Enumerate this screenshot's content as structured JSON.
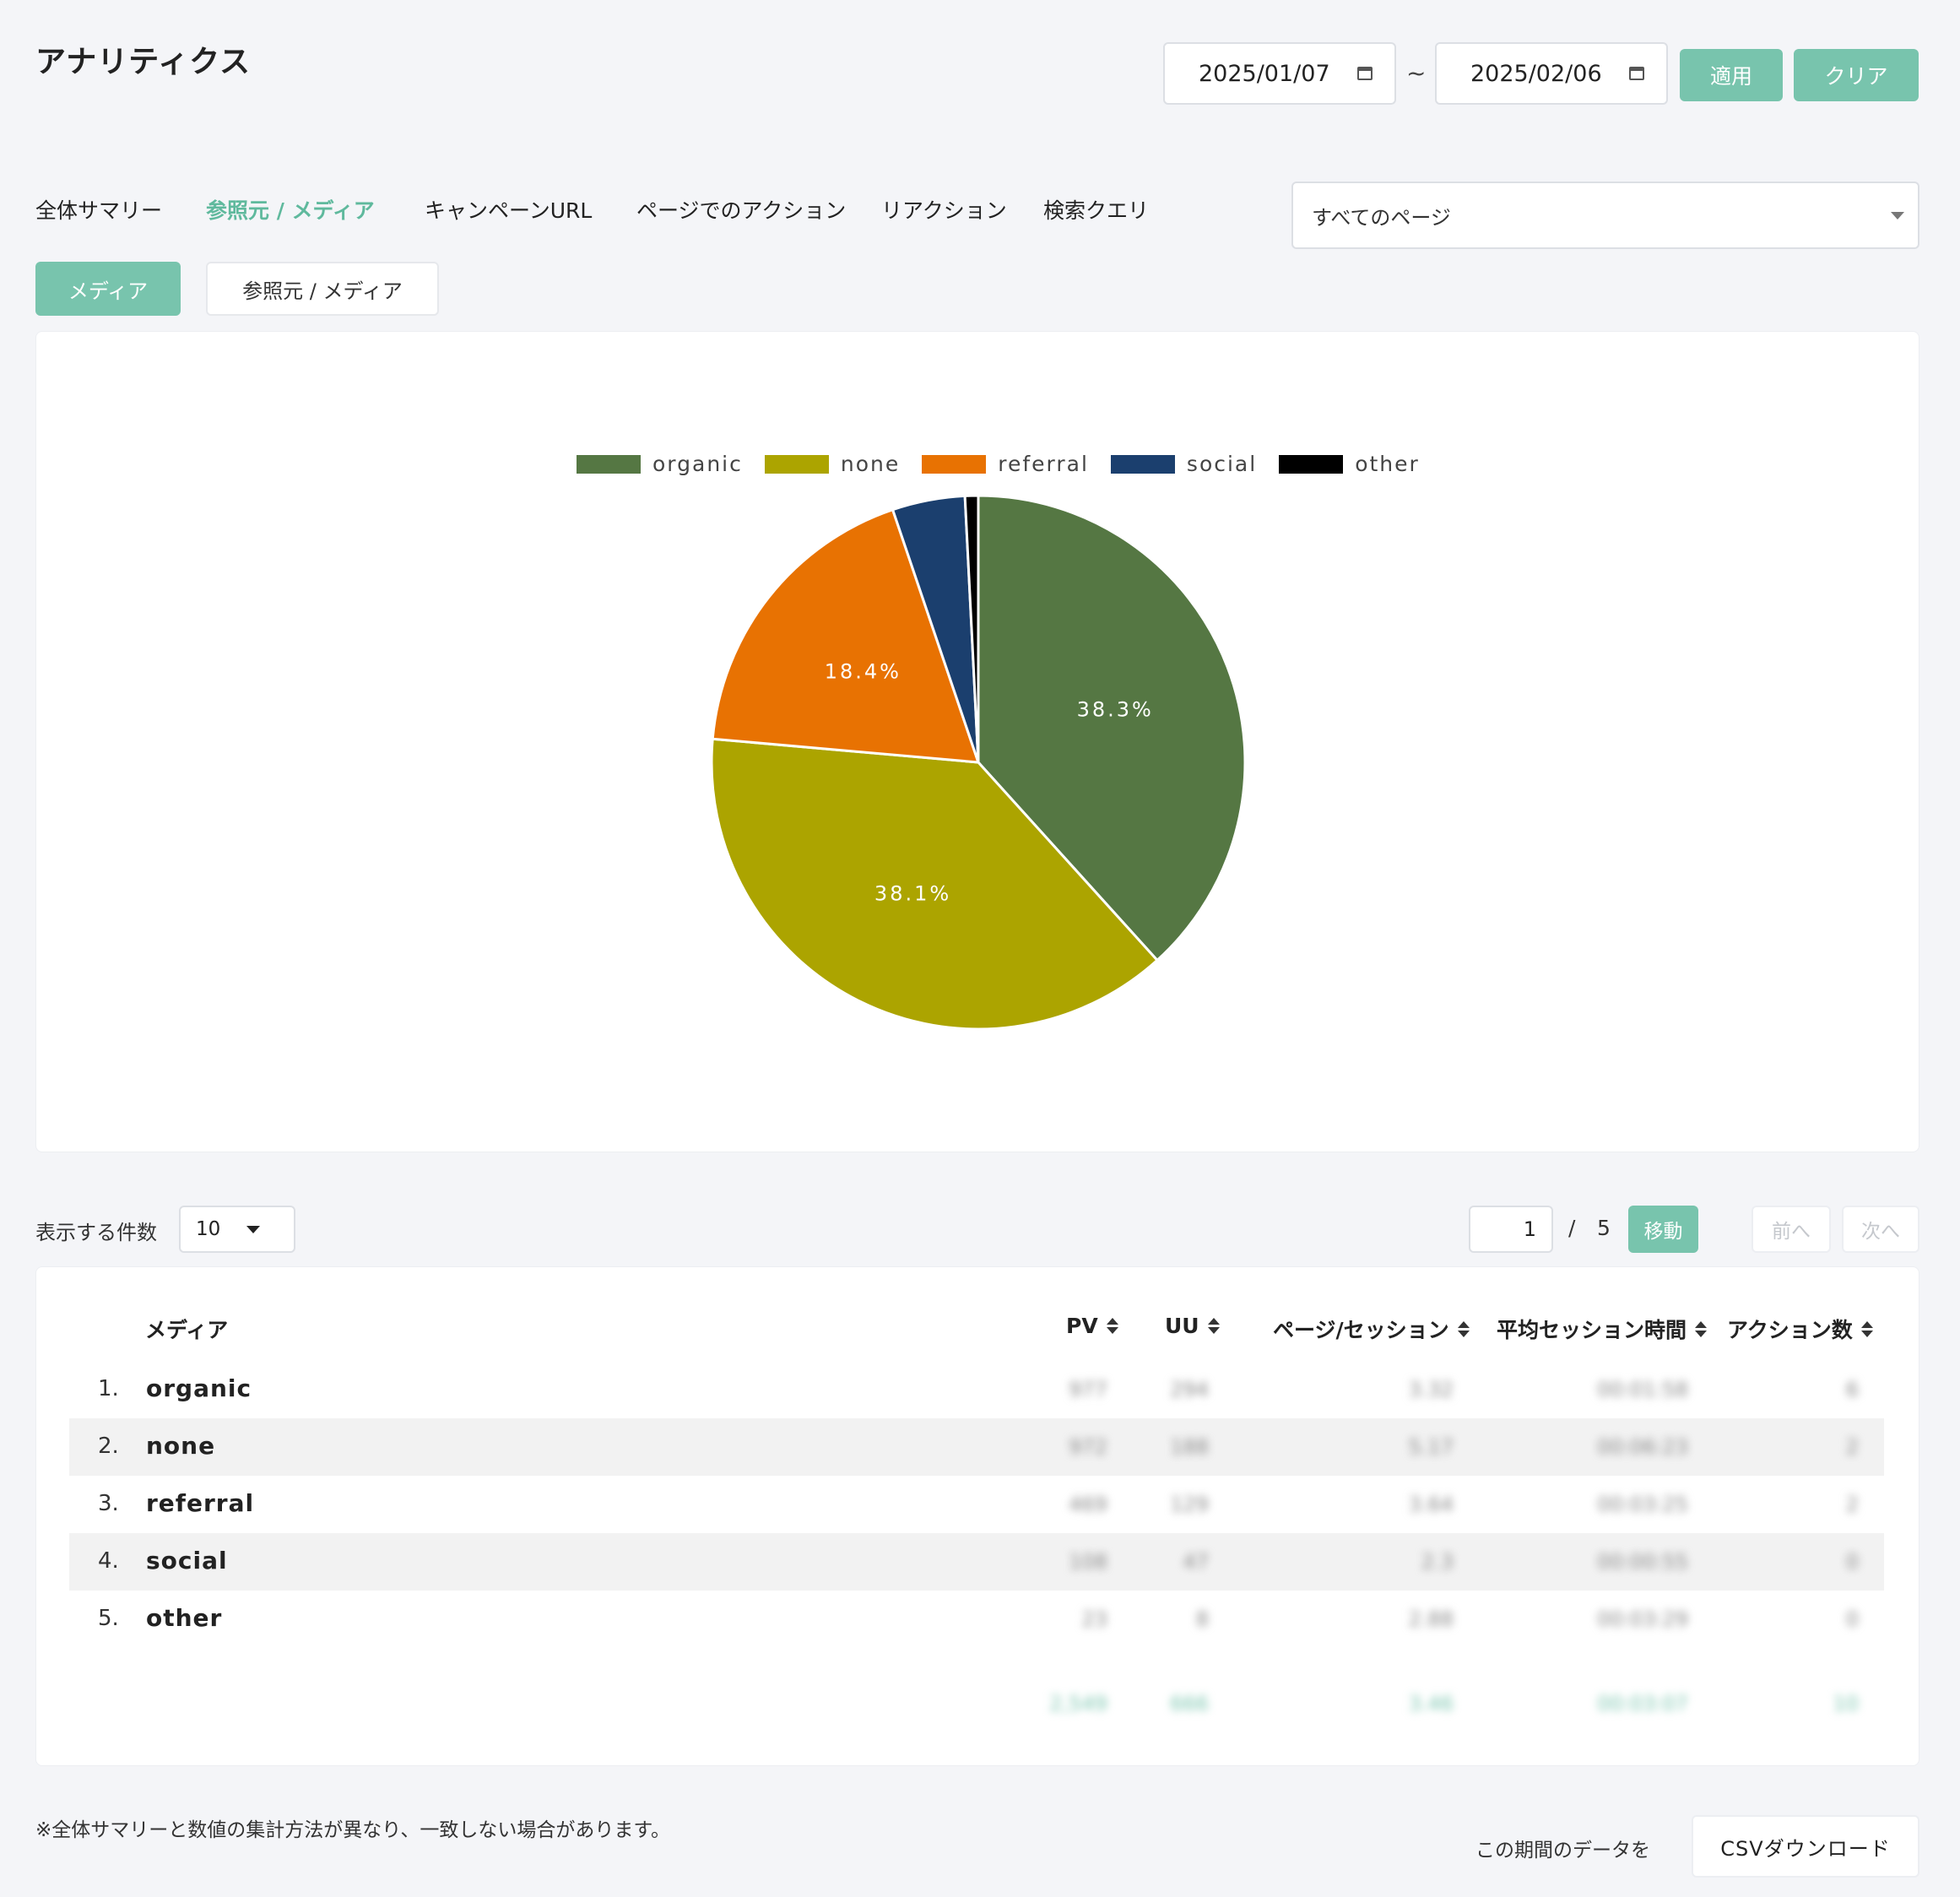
{
  "header": {
    "title": "アナリティクス",
    "date_from": "2025/01/07",
    "date_to": "2025/02/06",
    "range_separator": "~",
    "apply_label": "適用",
    "clear_label": "クリア"
  },
  "tabs": [
    {
      "label": "全体サマリー",
      "active": false
    },
    {
      "label": "参照元 / メディア",
      "active": true
    },
    {
      "label": "キャンペーンURL",
      "active": false
    },
    {
      "label": "ページでのアクション",
      "active": false
    },
    {
      "label": "リアクション",
      "active": false
    },
    {
      "label": "検索クエリ",
      "active": false
    }
  ],
  "page_filter": {
    "selected": "すべてのページ"
  },
  "subtabs": [
    {
      "label": "メディア",
      "active": true
    },
    {
      "label": "参照元 / メディア",
      "active": false
    }
  ],
  "colors": {
    "accent": "#78c4ad",
    "organic": "#557743",
    "none": "#aca400",
    "referral": "#e87202",
    "social": "#1b3f6e",
    "other": "#000000"
  },
  "chart_data": {
    "type": "pie",
    "legend_position": "top",
    "categories": [
      "organic",
      "none",
      "referral",
      "social",
      "other"
    ],
    "values": [
      38.3,
      38.1,
      18.4,
      4.4,
      0.8
    ],
    "data_labels": [
      "38.3%",
      "38.1%",
      "18.4%",
      "",
      ""
    ],
    "title": ""
  },
  "pager": {
    "per_page_label": "表示する件数",
    "per_page": "10",
    "current_page": "1",
    "separator": "/",
    "total_pages": "5",
    "go_label": "移動",
    "prev_label": "前へ",
    "next_label": "次へ"
  },
  "table": {
    "columns": {
      "media": "メディア",
      "pv": "PV",
      "uu": "UU",
      "pages_per_session": "ページ/セッション",
      "avg_session": "平均セッション時間",
      "actions": "アクション数"
    },
    "rows": [
      {
        "num": "1.",
        "name": "organic",
        "pv": "977",
        "uu": "294",
        "pps": "3.32",
        "avg": "00:01:58",
        "act": "6"
      },
      {
        "num": "2.",
        "name": "none",
        "pv": "972",
        "uu": "188",
        "pps": "5.17",
        "avg": "00:06:23",
        "act": "2"
      },
      {
        "num": "3.",
        "name": "referral",
        "pv": "469",
        "uu": "129",
        "pps": "3.64",
        "avg": "00:03:25",
        "act": "2"
      },
      {
        "num": "4.",
        "name": "social",
        "pv": "108",
        "uu": "47",
        "pps": "2.3",
        "avg": "00:00:55",
        "act": "0"
      },
      {
        "num": "5.",
        "name": "other",
        "pv": "23",
        "uu": "8",
        "pps": "2.88",
        "avg": "00:03:29",
        "act": "0"
      }
    ],
    "totals": {
      "pv": "2,549",
      "uu": "666",
      "pps": "3.46",
      "avg": "00:03:07",
      "act": "10"
    }
  },
  "footer": {
    "note": "※全体サマリーと数値の集計方法が異なり、一致しない場合があります。",
    "download_prefix": "この期間のデータを",
    "download_label": "CSVダウンロード"
  }
}
